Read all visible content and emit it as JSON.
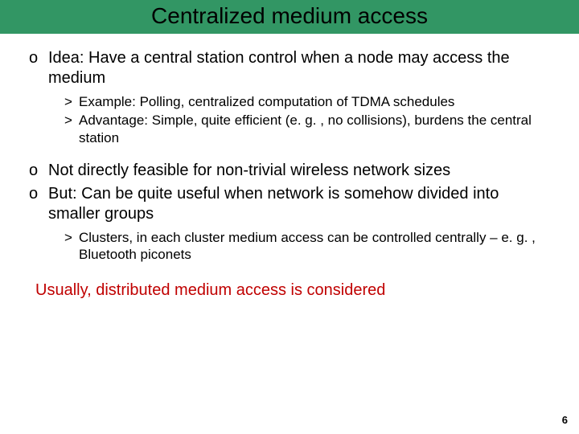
{
  "title": "Centralized medium access",
  "bullets": [
    {
      "text": "Idea: Have a central station control when a node may access the medium",
      "subs": [
        "Example: Polling, centralized computation of TDMA schedules",
        "Advantage: Simple, quite efficient (e. g. , no collisions), burdens the central station"
      ]
    },
    {
      "text": "Not directly feasible for non-trivial wireless network sizes",
      "subs": []
    },
    {
      "text": "But: Can be quite useful when network is somehow divided into smaller groups",
      "subs": [
        "Clusters, in each cluster medium access can be controlled centrally – e. g. , Bluetooth piconets"
      ]
    }
  ],
  "closing": "Usually, distributed medium access is considered",
  "page_number": "6",
  "markers": {
    "main": "o",
    "sub": ">"
  }
}
